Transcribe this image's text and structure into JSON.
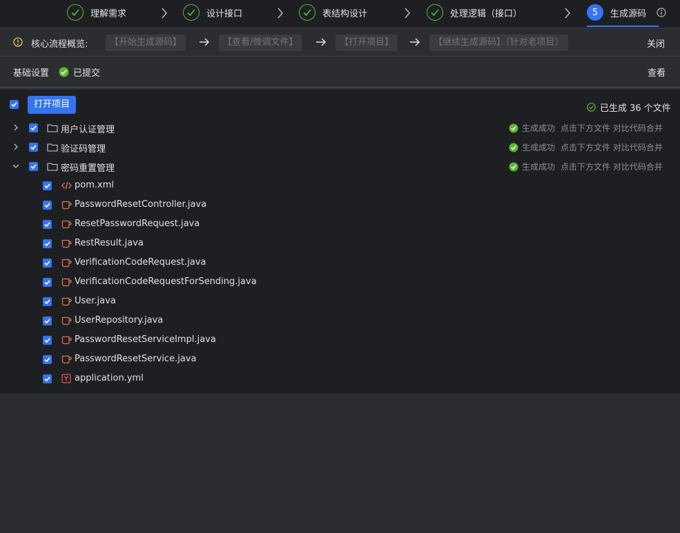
{
  "stepper": {
    "steps": [
      {
        "label": "理解需求",
        "state": "done"
      },
      {
        "label": "设计接口",
        "state": "done"
      },
      {
        "label": "表结构设计",
        "state": "done"
      },
      {
        "label": "处理逻辑（接口）",
        "state": "done"
      },
      {
        "label": "生成源码",
        "state": "active",
        "number": "5"
      }
    ]
  },
  "overview": {
    "title": "核心流程概览:",
    "chips": [
      "【开始生成源码】",
      "【查看/微调文件】",
      "【打开项目】",
      "【继续生成源码】（针对老项目）"
    ],
    "close_label": "关闭"
  },
  "basic": {
    "title": "基础设置",
    "status": "已提交",
    "view_label": "查看"
  },
  "tree": {
    "open_button": "打开项目",
    "generated_count": "已生成 36 个文件",
    "folders": [
      {
        "name": "用户认证管理",
        "status": "生成成功",
        "hint": "点击下方文件 对比代码合并",
        "expanded": false
      },
      {
        "name": "验证码管理",
        "status": "生成成功",
        "hint": "点击下方文件 对比代码合并",
        "expanded": false
      },
      {
        "name": "密码重置管理",
        "status": "生成成功",
        "hint": "点击下方文件 对比代码合并",
        "expanded": true
      }
    ],
    "files": [
      {
        "name": "pom.xml",
        "icon": "xml-icon"
      },
      {
        "name": "PasswordResetController.java",
        "icon": "java-icon"
      },
      {
        "name": "ResetPasswordRequest.java",
        "icon": "java-icon"
      },
      {
        "name": "RestResult.java",
        "icon": "java-icon"
      },
      {
        "name": "VerificationCodeRequest.java",
        "icon": "java-icon"
      },
      {
        "name": "VerificationCodeRequestForSending.java",
        "icon": "java-icon"
      },
      {
        "name": "User.java",
        "icon": "java-icon"
      },
      {
        "name": "UserRepository.java",
        "icon": "java-icon"
      },
      {
        "name": "PasswordResetServiceImpl.java",
        "icon": "java-icon"
      },
      {
        "name": "PasswordResetService.java",
        "icon": "java-icon"
      },
      {
        "name": "application.yml",
        "icon": "yaml-icon"
      }
    ]
  },
  "colors": {
    "accent": "#3574f0",
    "success": "#5fb832",
    "warning": "#f2c55c",
    "java_icon": "#e07a4f",
    "yaml_icon": "#db5c5c"
  }
}
